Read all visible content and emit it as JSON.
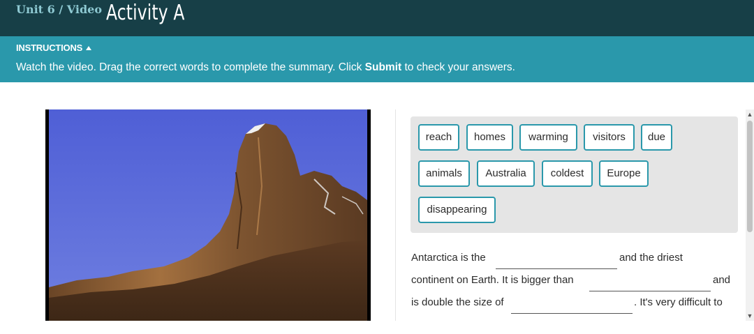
{
  "header": {
    "unit_label": "Unit 6 / Video",
    "title": "Activity A"
  },
  "instructions": {
    "toggle_label": "INSTRUCTIONS",
    "text_before": "Watch the video. Drag the correct words to complete the summary. Click ",
    "text_bold": "Submit",
    "text_after": " to check your answers."
  },
  "word_bank": [
    "reach",
    "homes",
    "warming",
    "visitors",
    "due",
    "animals",
    "Australia",
    "coldest",
    "Europe",
    "disappearing"
  ],
  "summary": {
    "line1_a": "Antarctica is the",
    "line1_b": "and the driest",
    "line2_a": "continent on Earth. It is bigger than",
    "line2_b": "and",
    "line3_a": "is double the size of",
    "line3_b": ". It's very difficult to"
  },
  "colors": {
    "header_bg": "#173f47",
    "instructions_bg": "#2a98ab",
    "chip_border": "#2a98ab",
    "bank_bg": "#e5e5e5"
  },
  "icons": {
    "instructions_toggle": "caret-up-icon",
    "scroll_up": "chevron-up-icon",
    "scroll_down": "chevron-down-icon"
  }
}
